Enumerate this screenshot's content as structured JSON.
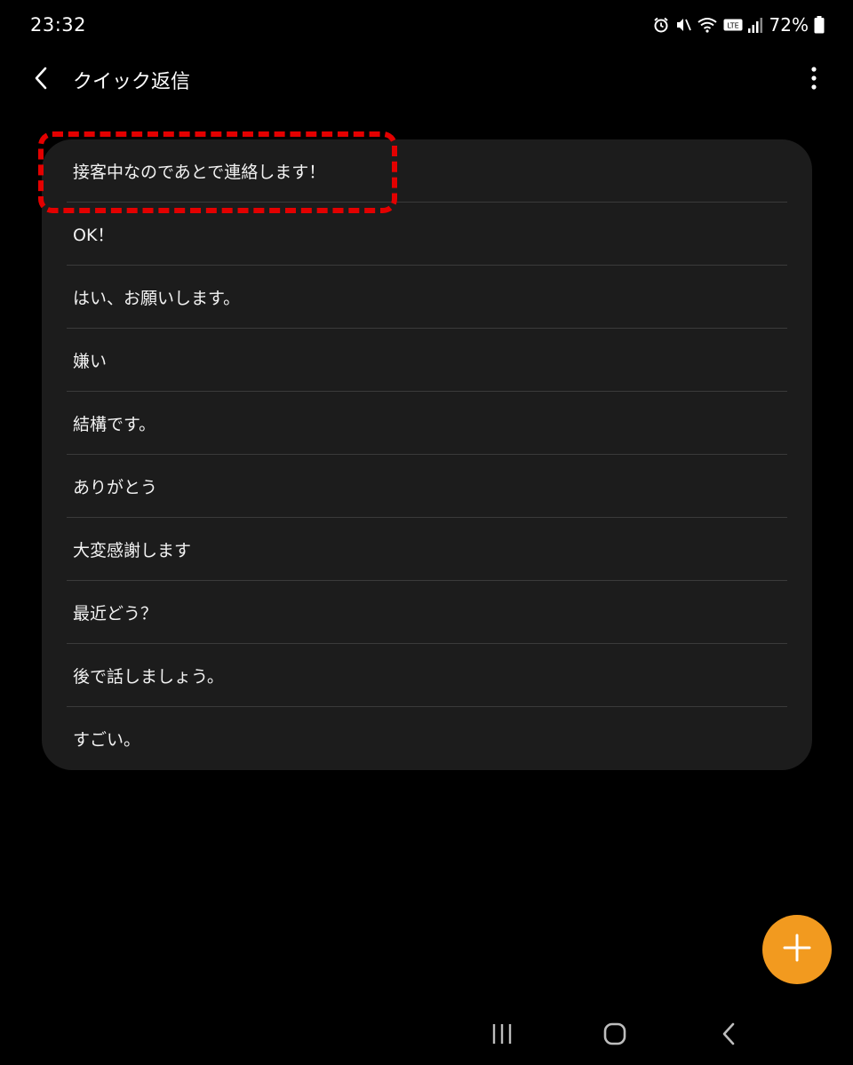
{
  "status_bar": {
    "time": "23:32",
    "battery_percent": "72%",
    "icons": [
      "alarm-icon",
      "mute-icon",
      "wifi-icon",
      "volte-icon",
      "signal-icon",
      "battery-icon"
    ]
  },
  "header": {
    "title": "クイック返信",
    "back_icon": "chevron-left-icon",
    "more_icon": "more-vertical-icon"
  },
  "quick_replies": [
    {
      "label": "接客中なのであとで連絡します！"
    },
    {
      "label": "OK！"
    },
    {
      "label": "はい、お願いします。"
    },
    {
      "label": "嫌い"
    },
    {
      "label": "結構です。"
    },
    {
      "label": "ありがとう"
    },
    {
      "label": "大変感謝します"
    },
    {
      "label": "最近どう？"
    },
    {
      "label": "後で話しましょう。"
    },
    {
      "label": "すごい。"
    }
  ],
  "fab": {
    "icon": "plus-icon"
  },
  "nav_bar": {
    "icons": [
      "recents-icon",
      "home-icon",
      "back-icon"
    ]
  },
  "colors": {
    "background": "#000000",
    "card": "#1c1c1c",
    "divider": "#3a3a3a",
    "accent": "#f29a1f",
    "highlight": "#e30000"
  }
}
